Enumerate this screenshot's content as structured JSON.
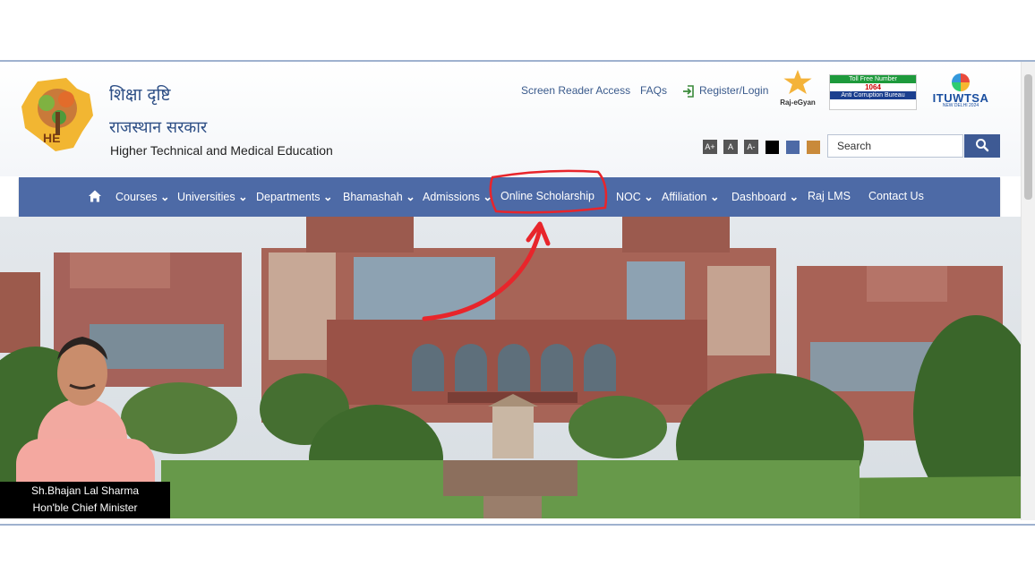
{
  "header": {
    "brand_hindi_1": "शिक्षा दृष्टि",
    "brand_hindi_2": "राजस्थान सरकार",
    "brand_english": "Higher Technical and Medical Education",
    "logo_letters": "HE"
  },
  "top_links": {
    "screen_reader": "Screen Reader Access",
    "faqs": "FAQs",
    "register_login": "Register/Login"
  },
  "partners": {
    "raj_egyan": "Raj-eGyan",
    "tollfree_line1": "Toll Free Number",
    "tollfree_number": "1064",
    "tollfree_line2": "Anti Corruption Bureau",
    "ituwtsa": "ITUWTSA",
    "ituwtsa_sub": "NEW DELHI 2024"
  },
  "accessibility": {
    "font_increase": "A+",
    "font_normal": "A",
    "font_decrease": "A-",
    "theme_colors": [
      "#000000",
      "#4d6aa6",
      "#c98a3a"
    ]
  },
  "search": {
    "placeholder": "Search"
  },
  "nav": {
    "items": [
      {
        "label": "Courses",
        "dropdown": true
      },
      {
        "label": "Universities",
        "dropdown": true
      },
      {
        "label": "Departments",
        "dropdown": true
      },
      {
        "label": "Bhamashah",
        "dropdown": true
      },
      {
        "label": "Admissions",
        "dropdown": true
      },
      {
        "label": "Online Scholarship",
        "dropdown": false
      },
      {
        "label": "NOC",
        "dropdown": true
      },
      {
        "label": "Affiliation",
        "dropdown": true
      },
      {
        "label": "Dashboard",
        "dropdown": true
      },
      {
        "label": "Raj LMS",
        "dropdown": false
      },
      {
        "label": "Contact Us",
        "dropdown": false
      }
    ],
    "chevron": "⌄"
  },
  "hero": {
    "caption_name": "Sh.Bhajan Lal Sharma",
    "caption_title": "Hon'ble Chief Minister"
  },
  "colors": {
    "nav_bg": "#4d6aa6",
    "brand_text": "#2e4f86",
    "annotation": "#e8252b"
  }
}
